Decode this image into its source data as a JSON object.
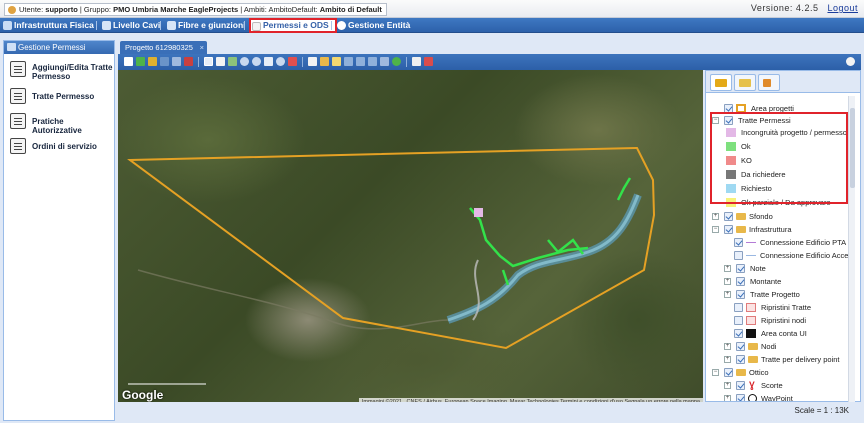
{
  "userbar": {
    "user_label": "Utente:",
    "user": "supporto",
    "group_label": "Gruppo:",
    "group": "PMO Umbria Marche EagleProjects",
    "ambiti_label": "Ambiti:",
    "ambiti": "AmbitoDefault:",
    "ambito_default": "Ambito di Default",
    "version": "Versione: 4.2.5",
    "logout": "Logout"
  },
  "menu": [
    {
      "label": "Infrastruttura Fisica"
    },
    {
      "label": "Livello Cavi"
    },
    {
      "label": "Fibre e giunzioni"
    },
    {
      "label": "Permessi e ODS"
    },
    {
      "label": "Gestione Entità"
    }
  ],
  "left_panel": {
    "title": "Gestione Permessi",
    "items": [
      {
        "label": "Aggiungi/Edita Tratte Permesso"
      },
      {
        "label": "Tratte Permesso"
      },
      {
        "label": "Pratiche Autorizzative"
      },
      {
        "label": "Ordini di servizio"
      }
    ]
  },
  "tab": {
    "label": "Progetto 612980325"
  },
  "map": {
    "google": "Google",
    "attribution": "Immagini ©2021 , CNES / Airbus, European Space Imaging, Maxar Technologies   Termini e condizioni d'uso   Segnala un errore nella mappa"
  },
  "layers": [
    {
      "label": "Area progetti"
    },
    {
      "label": "Tratte Permessi"
    },
    {
      "label": "Incongruità progetto / permesso",
      "color": "#e3b8e6"
    },
    {
      "label": "Ok",
      "color": "#7ee07e"
    },
    {
      "label": "KO",
      "color": "#f08a8a"
    },
    {
      "label": "Da richiedere",
      "color": "#777777"
    },
    {
      "label": "Richiesto",
      "color": "#9fd9f2"
    },
    {
      "label": "Ok parziale / Da approvare",
      "color": "#f7f27a"
    },
    {
      "label": "Sfondo"
    },
    {
      "label": "Infrastruttura"
    },
    {
      "label": "Connessione Edificio PTA"
    },
    {
      "label": "Connessione Edificio Access"
    },
    {
      "label": "Note"
    },
    {
      "label": "Montante"
    },
    {
      "label": "Tratte Progetto"
    },
    {
      "label": "Ripristini Tratte"
    },
    {
      "label": "Ripristini nodi"
    },
    {
      "label": "Area conta UI"
    },
    {
      "label": "Nodi"
    },
    {
      "label": "Tratte per delivery point"
    },
    {
      "label": "Ottico"
    },
    {
      "label": "Scorte"
    },
    {
      "label": "WayPoint"
    }
  ],
  "status": {
    "scale": "Scale = 1 : 13K"
  }
}
